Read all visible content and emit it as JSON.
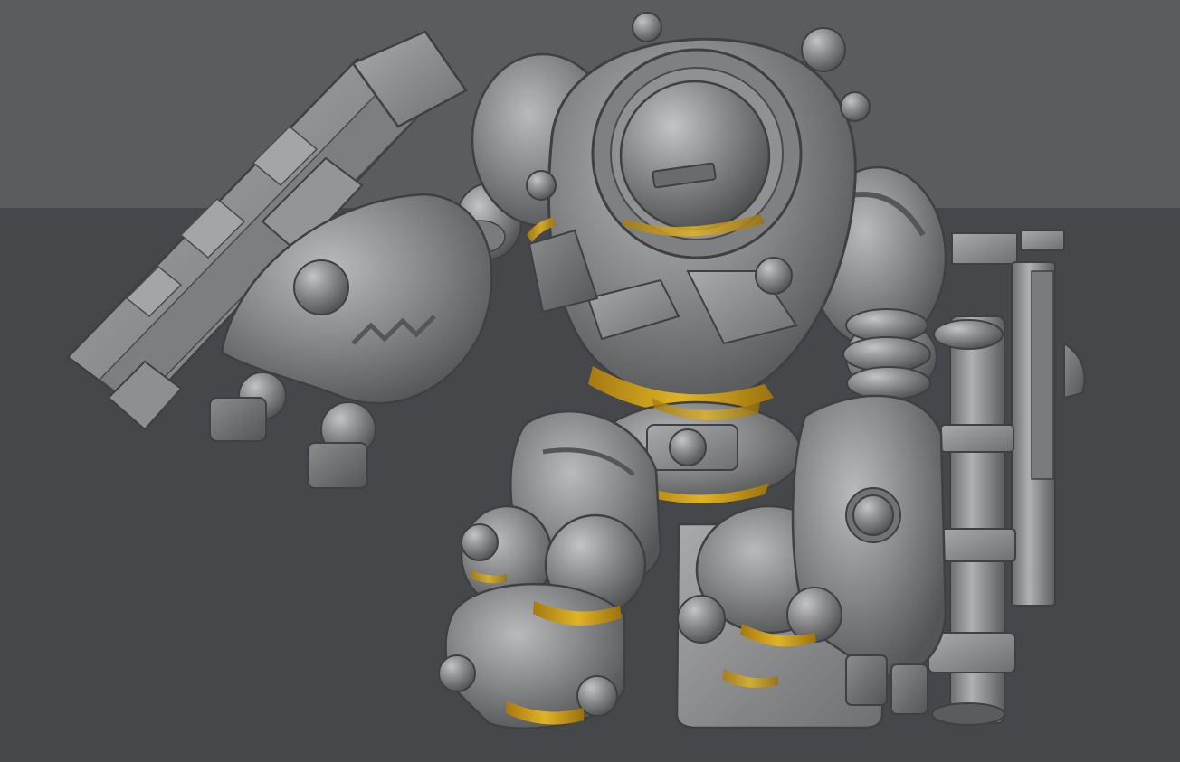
{
  "scene": {
    "subject": "armored-mech-figure-3d-render",
    "colors": {
      "backdrop": "#5b5c5e",
      "floor": "#46474a",
      "armor": "#8a8b8d",
      "armor_dark": "#5f6062",
      "armor_light": "#b4b5b7",
      "highlight": "#d9a91c"
    }
  }
}
